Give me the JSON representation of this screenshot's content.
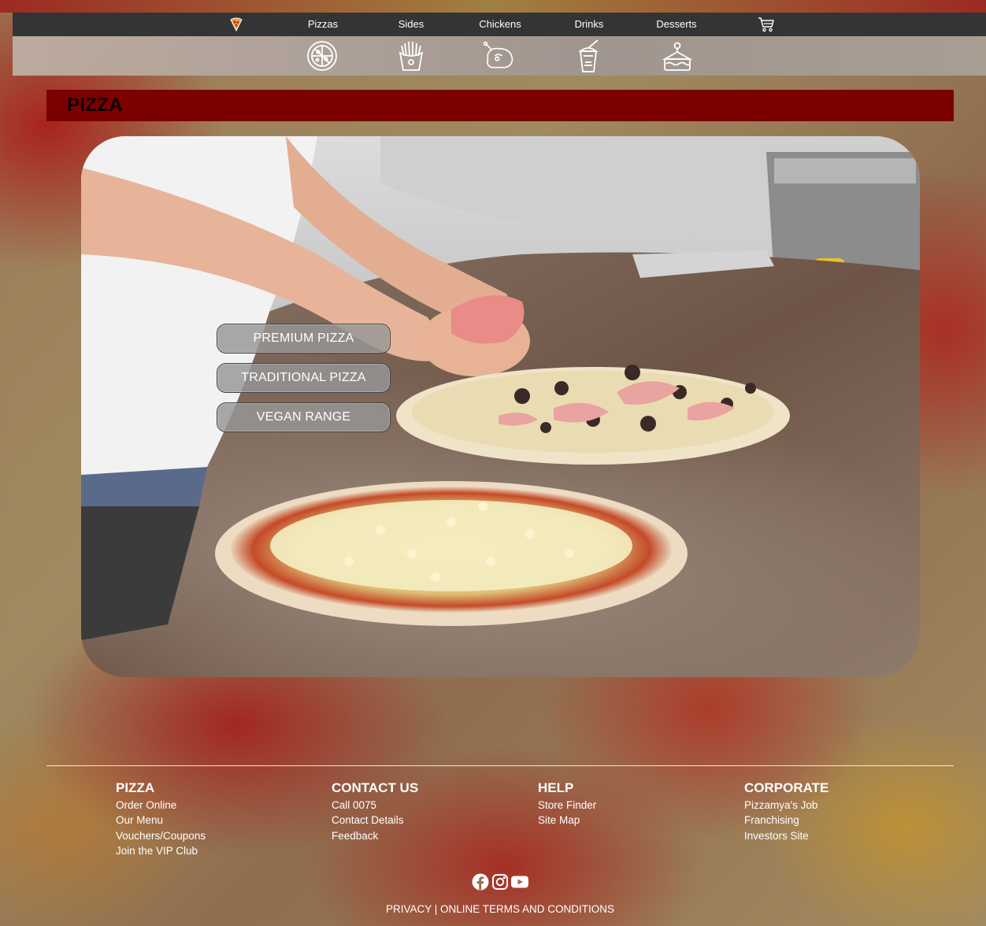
{
  "nav": {
    "logo_icon": "pizza-slice-icon",
    "items": [
      {
        "label": "Pizzas"
      },
      {
        "label": "Sides"
      },
      {
        "label": "Chickens"
      },
      {
        "label": "Drinks"
      },
      {
        "label": "Desserts"
      }
    ],
    "cart_icon": "shopping-cart-icon"
  },
  "category_icons": [
    "pizza-icon",
    "fries-icon",
    "chicken-icon",
    "drink-icon",
    "cake-icon"
  ],
  "page": {
    "title": "PIZZA"
  },
  "hero": {
    "buttons": [
      {
        "label": "PREMIUM PIZZA"
      },
      {
        "label": "TRADITIONAL PIZZA"
      },
      {
        "label": "VEGAN RANGE"
      }
    ]
  },
  "footer": {
    "columns": [
      {
        "heading": "PIZZA",
        "links": [
          "Order Online",
          "Our Menu",
          "Vouchers/Coupons",
          "Join the VIP Club"
        ]
      },
      {
        "heading": "CONTACT US",
        "links": [
          "Call 0075",
          "Contact Details",
          "Feedback"
        ]
      },
      {
        "heading": "HELP",
        "links": [
          "Store Finder",
          "Site Map"
        ]
      },
      {
        "heading": "CORPORATE",
        "links": [
          "Pizzamya's Job",
          "Franchising",
          "Investors Site"
        ]
      }
    ],
    "social_icons": [
      "facebook-icon",
      "instagram-icon",
      "youtube-icon"
    ],
    "legal": {
      "privacy": "PRIVACY",
      "separator": " | ",
      "terms": "ONLINE TERMS AND CONDITIONS"
    }
  },
  "colors": {
    "nav_bg": "#333436",
    "title_bar": "#7b0000",
    "text_light": "#ffffff"
  }
}
